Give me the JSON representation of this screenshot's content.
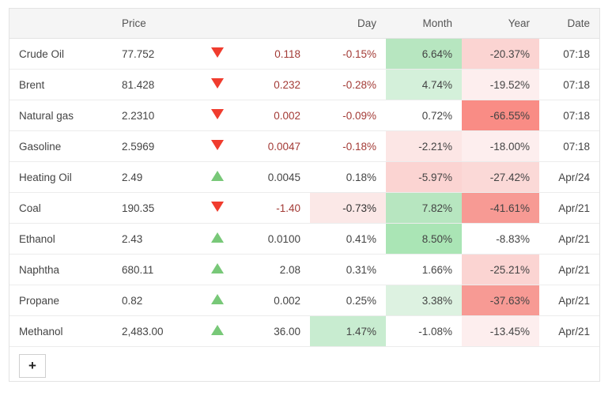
{
  "table": {
    "headers": {
      "name": "",
      "price": "Price",
      "arrow": "",
      "change": "",
      "day": "Day",
      "month": "Month",
      "year": "Year",
      "date": "Date"
    },
    "rows": [
      {
        "name": "Crude Oil",
        "price": "77.752",
        "direction": "down",
        "change": "0.118",
        "day": "-0.15%",
        "month": "6.64%",
        "year": "-20.37%",
        "date": "07:18",
        "day_bg": "",
        "month_bg": "#b7e6c0",
        "year_bg": "#fbd4d2"
      },
      {
        "name": "Brent",
        "price": "81.428",
        "direction": "down",
        "change": "0.232",
        "day": "-0.28%",
        "month": "4.74%",
        "year": "-19.52%",
        "date": "07:18",
        "day_bg": "",
        "month_bg": "#d4f0da",
        "year_bg": "#fdeeee"
      },
      {
        "name": "Natural gas",
        "price": "2.2310",
        "direction": "down",
        "change": "0.002",
        "day": "-0.09%",
        "month": "0.72%",
        "year": "-66.55%",
        "date": "07:18",
        "day_bg": "",
        "month_bg": "",
        "year_bg": "#f98c85"
      },
      {
        "name": "Gasoline",
        "price": "2.5969",
        "direction": "down",
        "change": "0.0047",
        "day": "-0.18%",
        "month": "-2.21%",
        "year": "-18.00%",
        "date": "07:18",
        "day_bg": "",
        "month_bg": "#fce6e5",
        "year_bg": "#fdeeee"
      },
      {
        "name": "Heating Oil",
        "price": "2.49",
        "direction": "up",
        "change": "0.0045",
        "day": "0.18%",
        "month": "-5.97%",
        "year": "-27.42%",
        "date": "Apr/24",
        "day_bg": "",
        "month_bg": "#fbd4d2",
        "year_bg": "#fbd9d7"
      },
      {
        "name": "Coal",
        "price": "190.35",
        "direction": "down",
        "change": "-1.40",
        "day": "-0.73%",
        "month": "7.82%",
        "year": "-41.61%",
        "date": "Apr/21",
        "day_bg": "#fbe8e7",
        "month_bg": "#b7e6c0",
        "year_bg": "#f79a94"
      },
      {
        "name": "Ethanol",
        "price": "2.43",
        "direction": "up",
        "change": "0.0100",
        "day": "0.41%",
        "month": "8.50%",
        "year": "-8.83%",
        "date": "Apr/21",
        "day_bg": "",
        "month_bg": "#aae5b5",
        "year_bg": ""
      },
      {
        "name": "Naphtha",
        "price": "680.11",
        "direction": "up",
        "change": "2.08",
        "day": "0.31%",
        "month": "1.66%",
        "year": "-25.21%",
        "date": "Apr/21",
        "day_bg": "",
        "month_bg": "",
        "year_bg": "#fbd4d2"
      },
      {
        "name": "Propane",
        "price": "0.82",
        "direction": "up",
        "change": "0.002",
        "day": "0.25%",
        "month": "3.38%",
        "year": "-37.63%",
        "date": "Apr/21",
        "day_bg": "",
        "month_bg": "#ddf2e1",
        "year_bg": "#f79a94"
      },
      {
        "name": "Methanol",
        "price": "2,483.00",
        "direction": "up",
        "change": "36.00",
        "day": "1.47%",
        "month": "-1.08%",
        "year": "-13.45%",
        "date": "Apr/21",
        "day_bg": "#c8ecd0",
        "month_bg": "",
        "year_bg": "#fdeeee"
      }
    ]
  },
  "footer": {
    "add_label": "+"
  },
  "colors": {
    "header_bg": "#f5f5f5",
    "border": "#e3e3e3",
    "row_border": "#ececec",
    "negative_text": "#a33b36",
    "positive_text": "#444444",
    "arrow_up": "#78c878",
    "arrow_down": "#f03c2e"
  }
}
